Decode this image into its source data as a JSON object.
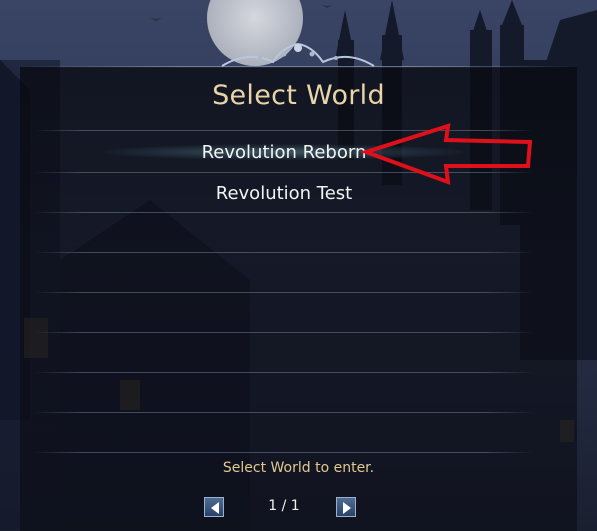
{
  "dialog": {
    "title": "Select World",
    "hint": "Select World to enter."
  },
  "worlds": [
    {
      "name": "Revolution Reborn",
      "selected": true
    },
    {
      "name": "Revolution Test",
      "selected": false
    }
  ],
  "pager": {
    "page_text": "1 / 1",
    "prev_icon": "triangle-left-icon",
    "next_icon": "triangle-right-icon"
  },
  "colors": {
    "title": "#e8d4a8",
    "hint": "#e2c890",
    "annotation_arrow": "#e0101a",
    "button_fill": "#3a5580"
  }
}
